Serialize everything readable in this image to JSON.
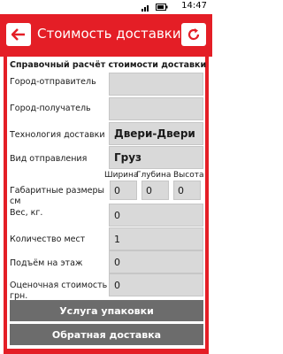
{
  "status_bar": {
    "time": "14:47"
  },
  "header": {
    "title": "Стоимость доставки",
    "back_icon": "arrow-left-icon",
    "refresh_icon": "refresh-icon"
  },
  "form": {
    "section_title": "Справочный расчёт стоимости доставки",
    "city_from": {
      "label": "Город-отправитель",
      "value": ""
    },
    "city_to": {
      "label": "Город-получатель",
      "value": ""
    },
    "technology": {
      "label": "Технология доставки",
      "value": "Двери-Двери"
    },
    "shipment_type": {
      "label": "Вид отправления",
      "value": "Груз"
    },
    "dimensions": {
      "label": "Габаритные размеры см",
      "width_label": "Ширина",
      "depth_label": "Глубина",
      "height_label": "Высота",
      "width": "0",
      "depth": "0",
      "height": "0"
    },
    "weight": {
      "label": "Вес, кг.",
      "value": "0"
    },
    "places": {
      "label": "Количество мест",
      "value": "1"
    },
    "floor_lift": {
      "label": "Подъём на этаж",
      "value": "0"
    },
    "declared_value": {
      "label": "Оценочная стоимость грн.",
      "value": "0"
    }
  },
  "buttons": {
    "packaging": "Услуга упаковки",
    "return_delivery": "Обратная доставка"
  }
}
